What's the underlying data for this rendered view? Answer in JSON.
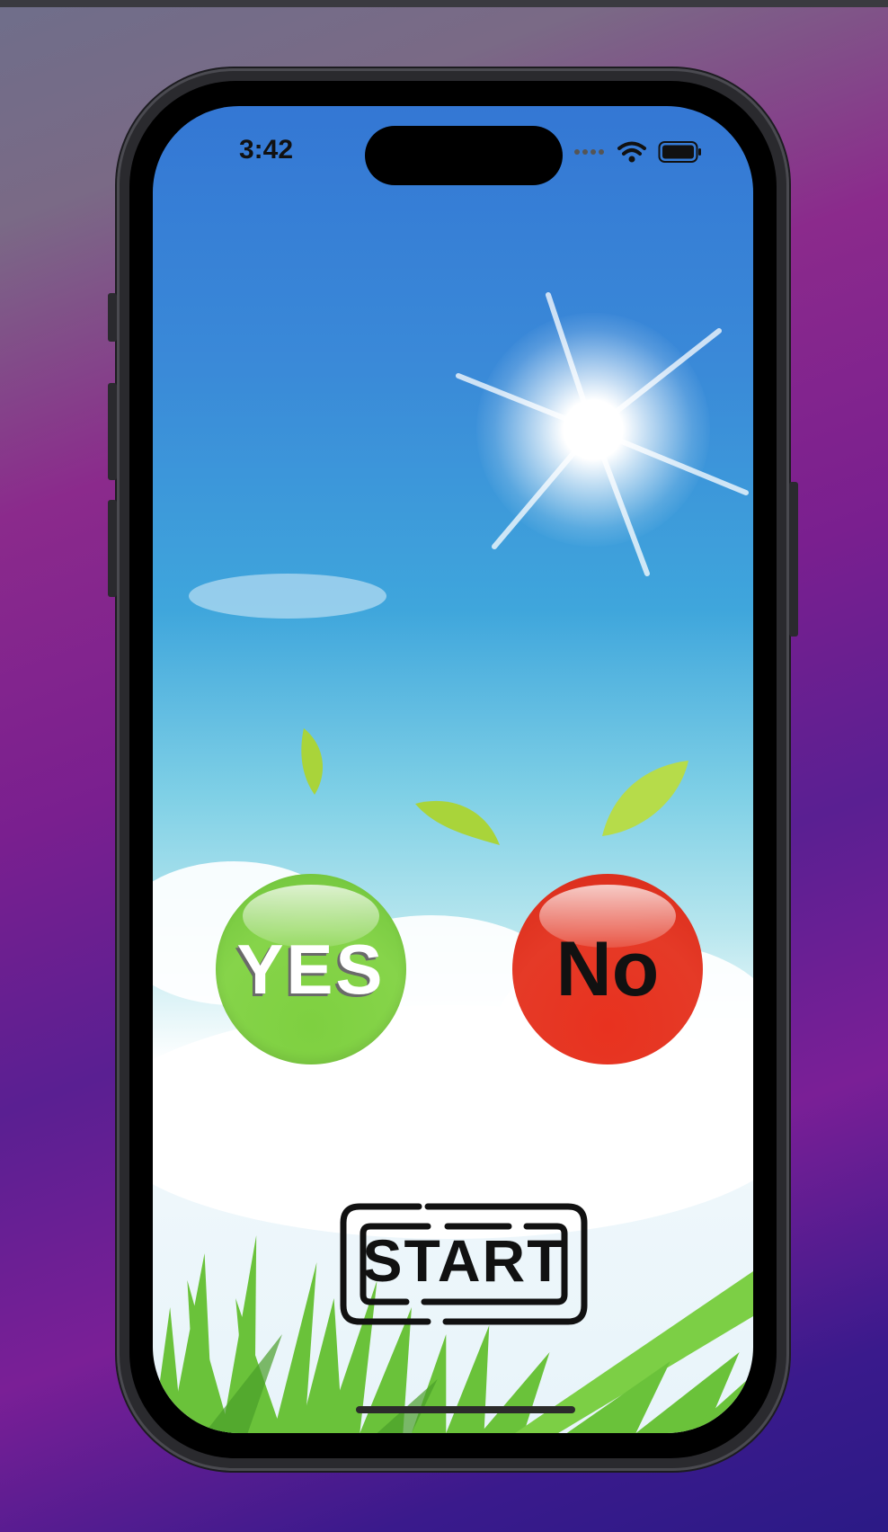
{
  "status_bar": {
    "time": "3:42",
    "signal_icon": "cellular-dots-icon",
    "wifi_icon": "wifi-icon",
    "battery_icon": "battery-icon"
  },
  "game": {
    "yes_button": {
      "label": "YES",
      "color": "#86d44a"
    },
    "no_button": {
      "label": "No",
      "color": "#e53a27"
    },
    "start_button": {
      "label": "START"
    }
  },
  "colors": {
    "sky_top": "#3477d4",
    "sky_mid": "#7fd0e6",
    "grass": "#6ac23a"
  }
}
